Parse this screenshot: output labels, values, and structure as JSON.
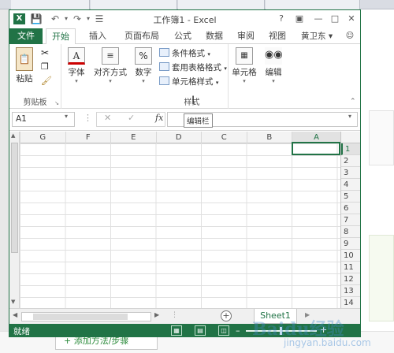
{
  "excel": {
    "title": "工作簿1 - Excel",
    "icon_label": "X",
    "tabs": [
      "文件",
      "开始",
      "插入",
      "页面布局",
      "公式",
      "数据",
      "审阅",
      "视图"
    ],
    "user": "黄卫东",
    "ribbon": {
      "clipboard": {
        "paste_label": "粘贴",
        "group_label": "剪贴板"
      },
      "font_label": "字体",
      "align_label": "对齐方式",
      "number_label": "数字",
      "styles": {
        "items": [
          "条件格式",
          "套用表格格式",
          "单元格样式"
        ],
        "group_label": "样式"
      },
      "cells_label": "单元格",
      "edit_label": "编辑"
    },
    "formula": {
      "name_box": "A1",
      "fx": "fx",
      "tooltip": "编辑栏"
    },
    "columns": [
      "G",
      "F",
      "E",
      "D",
      "C",
      "B",
      "A"
    ],
    "rows": [
      "1",
      "2",
      "3",
      "4",
      "5",
      "6",
      "7",
      "8",
      "9",
      "10",
      "11",
      "12",
      "13",
      "14"
    ],
    "sheet_tab": "Sheet1",
    "status": "就绪"
  },
  "background": {
    "add_button": "+ 添加方法/步骤",
    "watermark": "Baidu经验",
    "watermark_url": "jingyan.baidu.com"
  },
  "colors": {
    "excel_green": "#217346"
  }
}
